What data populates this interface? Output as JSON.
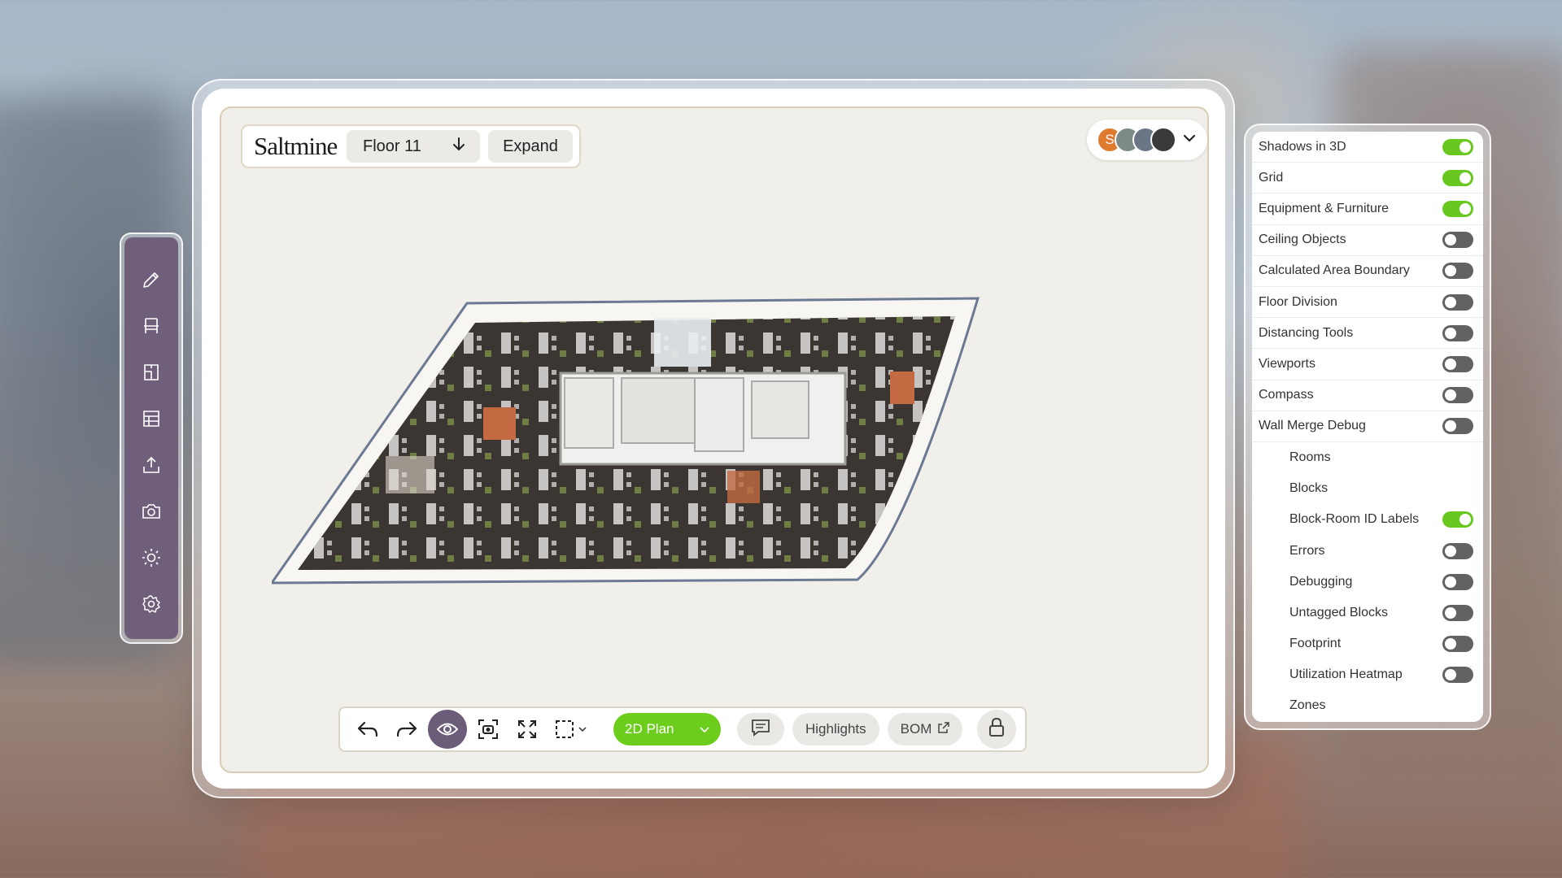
{
  "colors": {
    "accent_green": "#69c81f",
    "rail_purple": "#6f5f7b",
    "active_tool": "#6b5c79",
    "canvas_bg": "#f1efea"
  },
  "header": {
    "brand": "Saltmine",
    "floor_label": "Floor 11",
    "expand_label": "Expand"
  },
  "collaborators": {
    "first_initial": "S",
    "first_color": "#e07a2e"
  },
  "toolbar": {
    "view_mode": "2D Plan",
    "highlights_label": "Highlights",
    "bom_label": "BOM"
  },
  "rail": {
    "icons": [
      "pencil-icon",
      "chair-icon",
      "document-icon",
      "table-icon",
      "upload-icon",
      "camera-icon",
      "sun-icon",
      "gear-icon"
    ]
  },
  "layers": [
    {
      "label": "Shadows in 3D",
      "on": true,
      "child": false
    },
    {
      "label": "Grid",
      "on": true,
      "child": false
    },
    {
      "label": "Equipment & Furniture",
      "on": true,
      "child": false
    },
    {
      "label": "Ceiling Objects",
      "on": false,
      "child": false
    },
    {
      "label": "Calculated Area Boundary",
      "on": false,
      "child": false
    },
    {
      "label": "Floor Division",
      "on": false,
      "child": false
    },
    {
      "label": "Distancing Tools",
      "on": false,
      "child": false
    },
    {
      "label": "Viewports",
      "on": false,
      "child": false
    },
    {
      "label": "Compass",
      "on": false,
      "child": false
    },
    {
      "label": "Wall Merge Debug",
      "on": false,
      "child": false
    },
    {
      "label": "Rooms",
      "on": null,
      "child": true
    },
    {
      "label": "Blocks",
      "on": null,
      "child": true
    },
    {
      "label": "Block-Room ID Labels",
      "on": true,
      "child": true
    },
    {
      "label": "Errors",
      "on": false,
      "child": true
    },
    {
      "label": "Debugging",
      "on": false,
      "child": true
    },
    {
      "label": "Untagged Blocks",
      "on": false,
      "child": true
    },
    {
      "label": "Footprint",
      "on": false,
      "child": true
    },
    {
      "label": "Utilization Heatmap",
      "on": false,
      "child": true
    },
    {
      "label": "Zones",
      "on": null,
      "child": true
    }
  ]
}
